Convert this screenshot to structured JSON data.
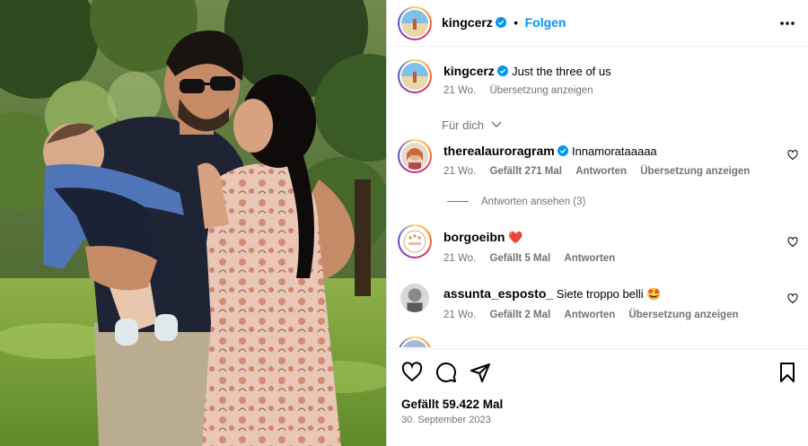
{
  "post": {
    "username": "kingcerz",
    "follow_label": "Folgen",
    "separator": "•",
    "more_icon": "more-horizontal-icon"
  },
  "caption": {
    "username": "kingcerz",
    "text": "Just the three of us",
    "time": "21 Wo.",
    "translate": "Übersetzung anzeigen"
  },
  "for_you_label": "Für dich",
  "comments": [
    {
      "username": "therealauroragram",
      "verified": true,
      "text": "Innamorataaaaa",
      "time": "21 Wo.",
      "likes": "Gefällt 271 Mal",
      "reply": "Antworten",
      "translate": "Übersetzung anzeigen",
      "view_replies": "Antworten ansehen (3)"
    },
    {
      "username": "borgoeibn",
      "verified": false,
      "text": "❤️",
      "time": "21 Wo.",
      "likes": "Gefällt 5 Mal",
      "reply": "Antworten"
    },
    {
      "username": "assunta_esposto_",
      "verified": false,
      "text": "Siete troppo belli 🤩",
      "time": "21 Wo.",
      "likes": "Gefällt 2 Mal",
      "reply": "Antworten",
      "translate": "Übersetzung anzeigen"
    }
  ],
  "footer": {
    "likes": "Gefällt 59.422 Mal",
    "date": "30. September 2023"
  },
  "colors": {
    "accent": "#0095f6",
    "muted": "#737373",
    "verified": "#0095f6"
  }
}
